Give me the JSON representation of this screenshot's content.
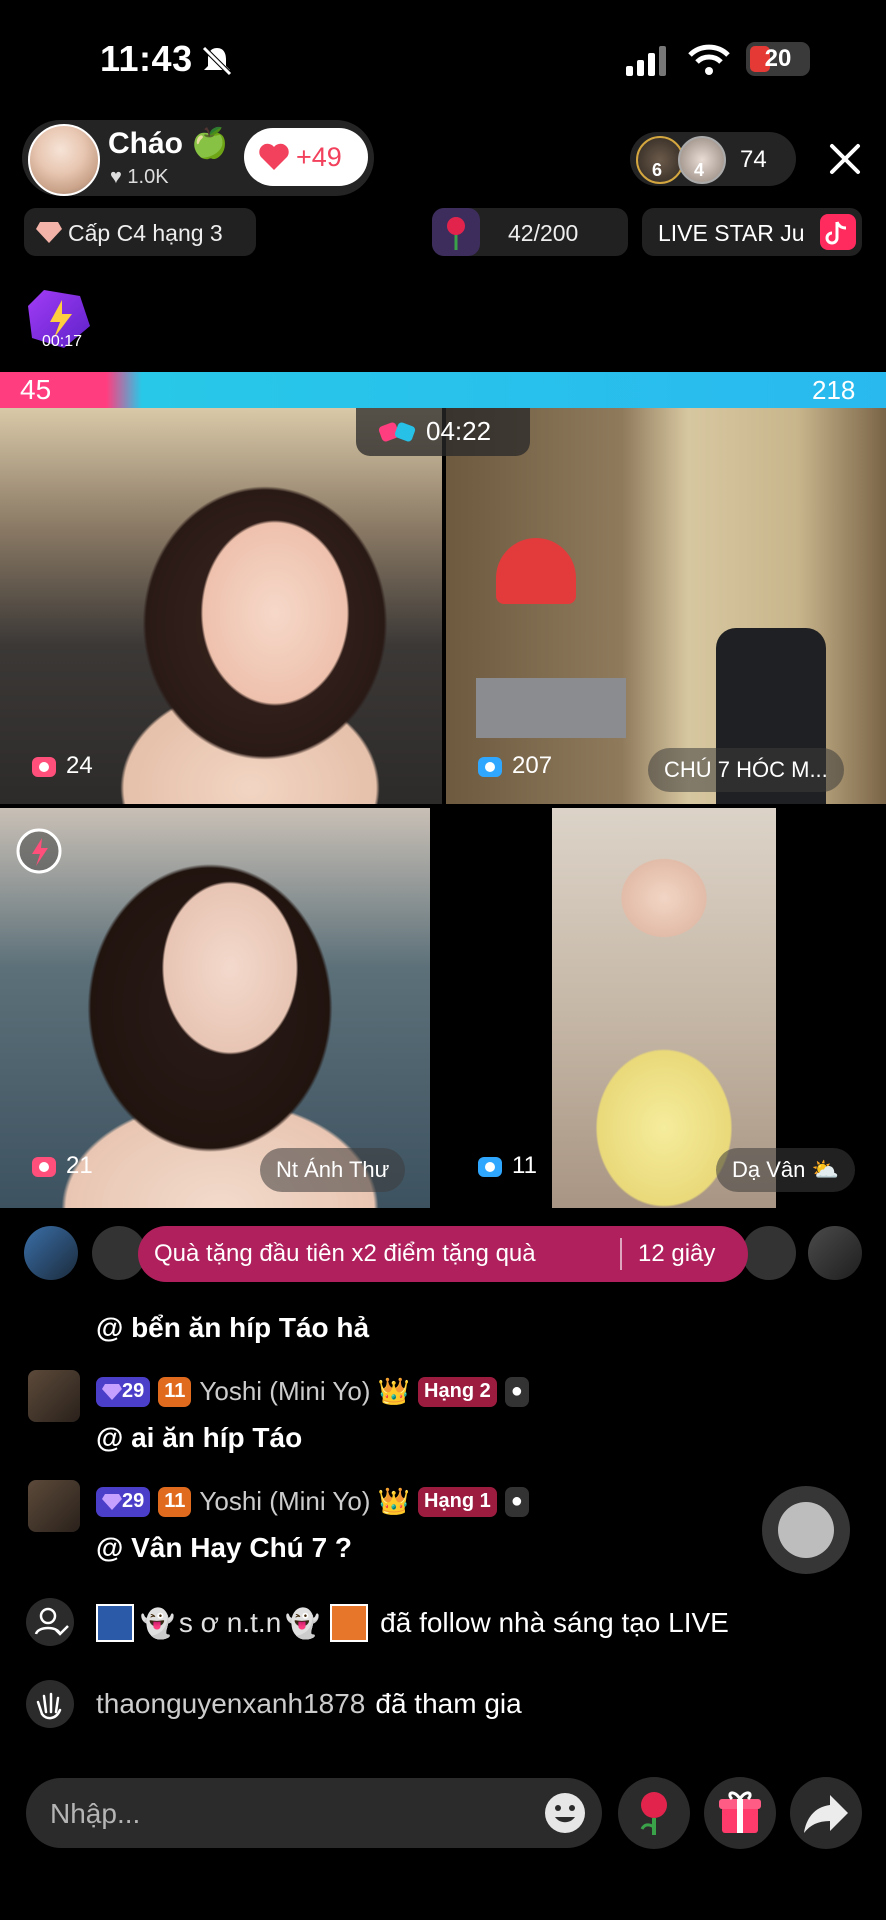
{
  "status_bar": {
    "time": "11:43",
    "battery": "20"
  },
  "host": {
    "name": "Cháo 🍏",
    "likes": "♥ 1.0K",
    "like_delta": "+49"
  },
  "viewers": {
    "count": "74",
    "badge_a": "6",
    "badge_b": "4"
  },
  "rank": {
    "label": "Cấp C4 hạng 3"
  },
  "goal": {
    "label": "42/200"
  },
  "live_star": {
    "label": "LIVE STAR Ju"
  },
  "boost": {
    "time": "00:17"
  },
  "battle": {
    "left_score": "45",
    "right_score": "218",
    "timer": "04:22"
  },
  "tiles": [
    {
      "points": "24",
      "name": ""
    },
    {
      "points": "207",
      "name": "CHÚ 7 HÓC M..."
    },
    {
      "points": "21",
      "name": "Nt Ánh Thư"
    },
    {
      "points": "11",
      "name": "Dạ Vân ⛅"
    }
  ],
  "gift_banner": {
    "text": "Quà tặng đầu tiên x2 điểm tặng quà",
    "seconds": "12 giây"
  },
  "chat": [
    {
      "message": "@ bển ăn híp Táo hả"
    },
    {
      "level": "29",
      "fan": "11",
      "user": "Yoshi (Mini Yo) 👑",
      "rank": "Hạng 2",
      "message": "@ ai ăn híp Táo"
    },
    {
      "level": "29",
      "fan": "11",
      "user": "Yoshi (Mini Yo) 👑",
      "rank": "Hạng 1",
      "message": "@ Vân Hay Chú 7 ?"
    }
  ],
  "system": [
    {
      "text": "s ơ n.t.n",
      "suffix": "đã follow nhà sáng tạo LIVE"
    },
    {
      "user": "thaonguyenxanh1878",
      "suffix": "đã tham gia"
    }
  ],
  "input": {
    "placeholder": "Nhập..."
  },
  "colors": {
    "accent_pink": "#ff3d7f",
    "accent_blue": "#29b9ef",
    "banner": "#b0205c"
  }
}
